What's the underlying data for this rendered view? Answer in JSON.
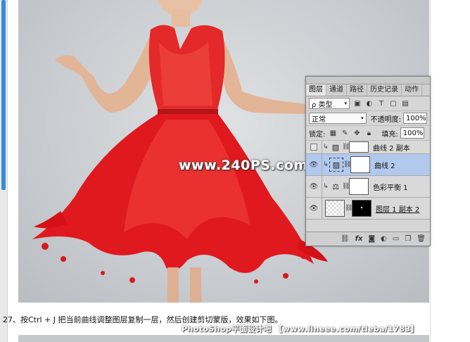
{
  "watermark": "www.240PS.com",
  "panel": {
    "tabs": [
      "图层",
      "通道",
      "路径",
      "历史记录",
      "动作"
    ],
    "kind_filter": "ρ 类型",
    "blend_mode": "正常",
    "opacity_label": "不透明度:",
    "opacity_value": "100%",
    "lock_label": "锁定:",
    "fill_label": "填充:",
    "fill_value": "100%",
    "layers": [
      {
        "name": "曲线 2 副本",
        "visible": false
      },
      {
        "name": "曲线 2",
        "visible": true
      },
      {
        "name": "色彩平衡 1",
        "visible": true
      },
      {
        "name": "图层 1 副本 2",
        "visible": true
      }
    ]
  },
  "caption": "27、按Ctrl + J 把当前曲线调整图层复制一层，然后创建剪切蒙版，效果如下图。",
  "credit": "PhotoShop平面设计吧 【www.lineee.com/tieba/1783】",
  "colors": {
    "selection": "#b2c9ee",
    "dress": "#e0191f",
    "scroll_thumb": "#3a8ad8"
  }
}
